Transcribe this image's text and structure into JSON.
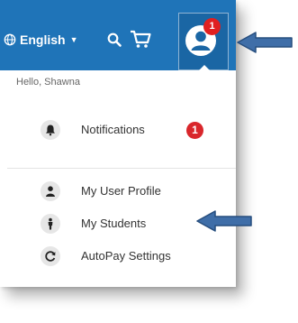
{
  "navbar": {
    "language_label": "English",
    "globe_icon": "globe-icon",
    "caret_icon": "caret-down-icon",
    "search_icon": "search-icon",
    "cart_icon": "cart-icon",
    "user_icon": "user-circle-icon",
    "notification_count": "1",
    "color": "#1f74b8"
  },
  "menu": {
    "greeting": "Hello, Shawna",
    "items": [
      {
        "label": "Notifications",
        "icon": "bell-icon",
        "count": "1"
      },
      {
        "label": "My User Profile",
        "icon": "user-icon"
      },
      {
        "label": "My Students",
        "icon": "student-icon"
      },
      {
        "label": "AutoPay Settings",
        "icon": "refresh-icon"
      }
    ]
  },
  "annotations": {
    "arrow_color": "#3f6ea8"
  }
}
